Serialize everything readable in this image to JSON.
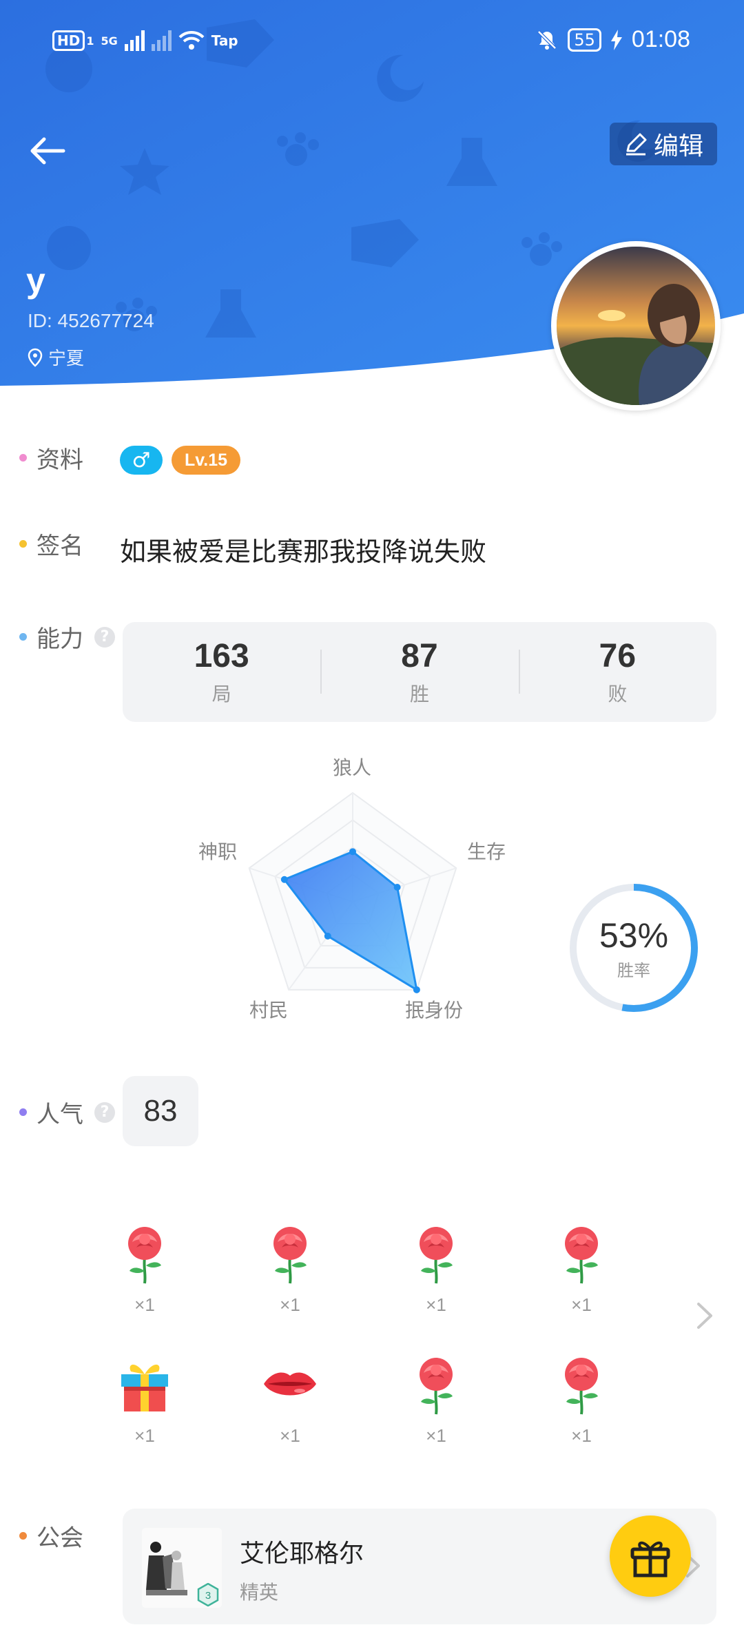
{
  "status_bar": {
    "hd": "HD",
    "sim_index": "1",
    "network": "5G",
    "wifi_label": "Tap",
    "battery": "55",
    "time": "01:08"
  },
  "header": {
    "edit_label": "编辑",
    "username": "y",
    "user_id": "ID: 452677724",
    "location": "宁夏",
    "accent_color": "#2e7be6"
  },
  "profile": {
    "label": "资料",
    "gender_symbol": "♂",
    "level": "Lv.15"
  },
  "signature": {
    "label": "签名",
    "text": "如果被爱是比赛那我投降说失败"
  },
  "ability": {
    "label": "能力",
    "stats": [
      {
        "value": "163",
        "label": "局"
      },
      {
        "value": "87",
        "label": "胜"
      },
      {
        "value": "76",
        "label": "败"
      }
    ],
    "radar": {
      "axes": [
        "狼人",
        "生存",
        "抿身份",
        "村民",
        "神职"
      ],
      "values": [
        0.46,
        0.43,
        1.0,
        0.39,
        0.66
      ]
    },
    "win_rate": {
      "value": "53%",
      "label": "胜率",
      "fraction": 0.53
    }
  },
  "popularity": {
    "label": "人气",
    "value": "83"
  },
  "gifts": [
    {
      "icon": "rose-icon",
      "count": "×1"
    },
    {
      "icon": "rose-icon",
      "count": "×1"
    },
    {
      "icon": "rose-icon",
      "count": "×1"
    },
    {
      "icon": "rose-icon",
      "count": "×1"
    },
    {
      "icon": "gift-box-icon",
      "count": "×1"
    },
    {
      "icon": "lips-icon",
      "count": "×1"
    },
    {
      "icon": "rose-icon",
      "count": "×1"
    },
    {
      "icon": "rose-icon",
      "count": "×1"
    }
  ],
  "guild": {
    "label": "公会",
    "name": "艾伦耶格尔",
    "rank": "精英",
    "badge_level": "3"
  }
}
